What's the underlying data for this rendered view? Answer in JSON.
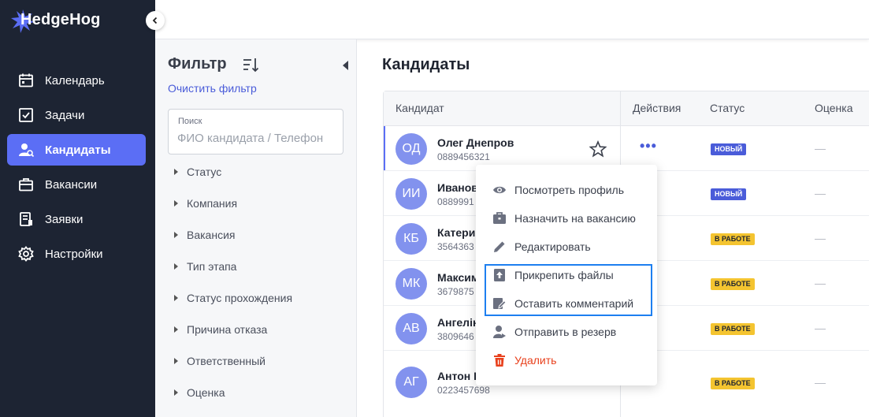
{
  "app": {
    "logo_text": "HedgeHog"
  },
  "sidebar": {
    "items": [
      {
        "label": "Календарь",
        "icon": "calendar-icon"
      },
      {
        "label": "Задачи",
        "icon": "checkbox-icon"
      },
      {
        "label": "Кандидаты",
        "icon": "candidate-icon",
        "active": true
      },
      {
        "label": "Вакансии",
        "icon": "briefcase-icon"
      },
      {
        "label": "Заявки",
        "icon": "request-icon"
      },
      {
        "label": "Настройки",
        "icon": "gear-icon"
      }
    ]
  },
  "filter": {
    "title": "Фильтр",
    "clear_label": "Очистить фильтр",
    "search": {
      "label": "Поиск",
      "placeholder": "ФИО кандидата / Телефон"
    },
    "facets": [
      "Статус",
      "Компания",
      "Вакансия",
      "Тип этапа",
      "Статус прохождения",
      "Причина отказа",
      "Ответственный",
      "Оценка"
    ]
  },
  "main": {
    "title": "Кандидаты",
    "columns": [
      "Кандидат",
      "Действия",
      "Статус",
      "Оценка"
    ],
    "rows": [
      {
        "initials": "ОД",
        "name": "Олег Днепров",
        "phone": "0889456321",
        "status": "НОВЫЙ",
        "status_kind": "new",
        "rating": "—"
      },
      {
        "initials": "ИИ",
        "name": "Иванов",
        "phone": "0889991",
        "status": "НОВЫЙ",
        "status_kind": "new",
        "rating": "—"
      },
      {
        "initials": "КБ",
        "name": "Катери",
        "phone": "3564363",
        "status": "В РАБОТЕ",
        "status_kind": "work",
        "rating": "—"
      },
      {
        "initials": "МК",
        "name": "Максим",
        "phone": "3679875",
        "status": "В РАБОТЕ",
        "status_kind": "work",
        "rating": "—"
      },
      {
        "initials": "АВ",
        "name": "Ангелін",
        "phone": "3809646",
        "status": "В РАБОТЕ",
        "status_kind": "work",
        "rating": "—"
      },
      {
        "initials": "АГ",
        "name": "Антон Г",
        "phone": "0223457698",
        "status": "В РАБОТЕ",
        "status_kind": "work",
        "rating": "—"
      }
    ],
    "actions_label": "•••"
  },
  "context_menu": {
    "items": [
      {
        "label": "Посмотреть профиль",
        "icon": "eye-icon"
      },
      {
        "label": "Назначить на вакансию",
        "icon": "briefcase-icon"
      },
      {
        "label": "Редактировать",
        "icon": "pencil-icon"
      },
      {
        "label": "Прикрепить файлы",
        "icon": "upload-file-icon"
      },
      {
        "label": "Оставить комментарий",
        "icon": "comment-edit-icon"
      },
      {
        "label": "Отправить в резерв",
        "icon": "person-reserve-icon"
      },
      {
        "label": "Удалить",
        "icon": "trash-icon",
        "danger": true
      }
    ]
  },
  "colors": {
    "sidebar_bg": "#1d2433",
    "accent": "#5b6ef5",
    "link": "#4a5cd9",
    "badge_new": "#4a5cd9",
    "badge_work": "#f4c430",
    "danger": "#e8401c",
    "highlight": "#1d7ff0"
  }
}
